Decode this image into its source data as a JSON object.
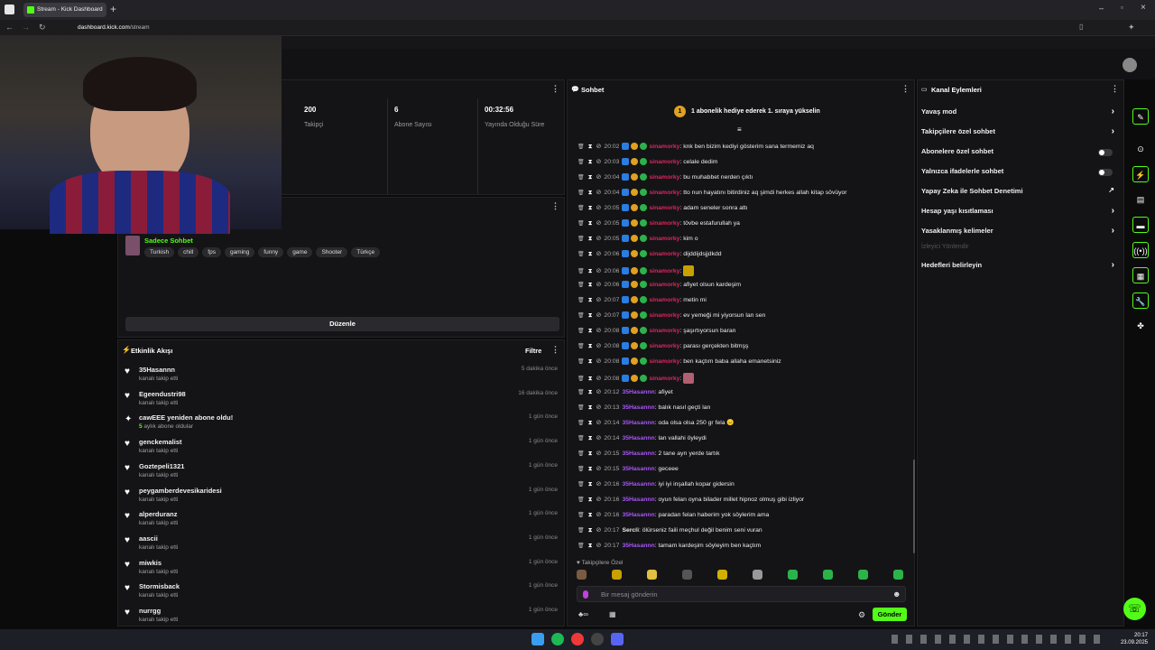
{
  "browser": {
    "tab_title": "Stream - Kick Dashboard",
    "url_host": "dashboard.kick.com",
    "url_path": "/stream"
  },
  "stats": [
    {
      "value": "200",
      "label": "Takipçi"
    },
    {
      "value": "6",
      "label": "Abone Sayısı"
    },
    {
      "value": "00:32:56",
      "label": "Yayında Olduğu Süre"
    }
  ],
  "stream_info": {
    "category": "Sadece Sohbet",
    "tags": [
      "Turkish",
      "chill",
      "fps",
      "gaming",
      "funny",
      "game",
      "Shooter",
      "Türkçe"
    ],
    "edit_button": "Düzenle"
  },
  "activity": {
    "title": "Etkinlik Akışı",
    "filter": "Filtre",
    "items": [
      {
        "name": "35Hasannn",
        "sub": "kanalı takip etti",
        "time": "5 dakika önce",
        "icon": "heart"
      },
      {
        "name": "Egeendustri98",
        "sub": "kanalı takip etti",
        "time": "16 dakika önce",
        "icon": "heart"
      },
      {
        "name": "cawEEE yeniden abone oldu!",
        "sub_accent": "5",
        "sub": " aylık abone oldular",
        "time": "1 gün önce",
        "icon": "star"
      },
      {
        "name": "genckemalist",
        "sub": "kanalı takip etti",
        "time": "1 gün önce",
        "icon": "heart"
      },
      {
        "name": "Goztepeli1321",
        "sub": "kanalı takip etti",
        "time": "1 gün önce",
        "icon": "heart"
      },
      {
        "name": "peygamberdevesikaridesi",
        "sub": "kanalı takip etti",
        "time": "1 gün önce",
        "icon": "heart"
      },
      {
        "name": "alperduranz",
        "sub": "kanalı takip etti",
        "time": "1 gün önce",
        "icon": "heart"
      },
      {
        "name": "aascii",
        "sub": "kanalı takip etti",
        "time": "1 gün önce",
        "icon": "heart"
      },
      {
        "name": "miwkis",
        "sub": "kanalı takip etti",
        "time": "1 gün önce",
        "icon": "heart"
      },
      {
        "name": "Stormisback",
        "sub": "kanalı takip etti",
        "time": "1 gün önce",
        "icon": "heart"
      },
      {
        "name": "nurrgg",
        "sub": "kanalı takip etti",
        "time": "1 gün önce",
        "icon": "heart"
      }
    ]
  },
  "chat": {
    "title": "Sohbet",
    "pinned": "1 abonelik hediye ederek 1. sıraya yükselin",
    "placeholder": "Bir mesaj gönderin",
    "send": "Gönder",
    "followers_only_label": "Takipçilere Özel",
    "messages": [
      {
        "time": "20:02",
        "user": "sinamorky",
        "color": "#e0245e",
        "badges": true,
        "text": ": knk ben bizim kediyi gösterim sana termemiz aq"
      },
      {
        "time": "20:03",
        "user": "sinamorky",
        "color": "#e0245e",
        "badges": true,
        "text": ": celale dedim"
      },
      {
        "time": "20:04",
        "user": "sinamorky",
        "color": "#e0245e",
        "badges": true,
        "text": ": bu muhabbet nerden çıktı"
      },
      {
        "time": "20:04",
        "user": "sinamorky",
        "color": "#e0245e",
        "badges": true,
        "text": ": tto nun hayatını bitirdiniz aq şimdi herkes allah kitap sövüyor"
      },
      {
        "time": "20:05",
        "user": "sinamorky",
        "color": "#e0245e",
        "badges": true,
        "text": ": adam seneler sonra attı"
      },
      {
        "time": "20:05",
        "user": "sinamorky",
        "color": "#e0245e",
        "badges": true,
        "text": ": tövbe estafurullah ya"
      },
      {
        "time": "20:05",
        "user": "sinamorky",
        "color": "#e0245e",
        "badges": true,
        "text": ": kim o"
      },
      {
        "time": "20:06",
        "user": "sinamorky",
        "color": "#e0245e",
        "badges": true,
        "text": ": dijddijdsjjdkdd"
      },
      {
        "time": "20:06",
        "user": "sinamorky",
        "color": "#e0245e",
        "badges": true,
        "text": ": ",
        "emote": "#c8a000"
      },
      {
        "time": "20:06",
        "user": "sinamorky",
        "color": "#e0245e",
        "badges": true,
        "text": ": afiyet olsun kardeşim"
      },
      {
        "time": "20:07",
        "user": "sinamorky",
        "color": "#e0245e",
        "badges": true,
        "text": ": metin mi"
      },
      {
        "time": "20:07",
        "user": "sinamorky",
        "color": "#e0245e",
        "badges": true,
        "text": ": ev yemeği mi yiyorsun lan sen"
      },
      {
        "time": "20:08",
        "user": "sinamorky",
        "color": "#e0245e",
        "badges": true,
        "text": ": şaşırtıyorsun baran"
      },
      {
        "time": "20:08",
        "user": "sinamorky",
        "color": "#e0245e",
        "badges": true,
        "text": ": parası gerçekten bitmşş"
      },
      {
        "time": "20:08",
        "user": "sinamorky",
        "color": "#e0245e",
        "badges": true,
        "text": ": ben kaçtım baba allaha emanetsiniz"
      },
      {
        "time": "20:08",
        "user": "sinamorky",
        "color": "#e0245e",
        "badges": true,
        "text": ": ",
        "emote": "#b06070"
      },
      {
        "time": "20:12",
        "user": "35Hasannn",
        "color": "#a855f7",
        "badges": false,
        "text": ": afiyet"
      },
      {
        "time": "20:13",
        "user": "35Hasannn",
        "color": "#a855f7",
        "badges": false,
        "text": ": balık nasıl geçti lan"
      },
      {
        "time": "20:14",
        "user": "35Hasannn",
        "color": "#a855f7",
        "badges": false,
        "text": ": oda olsa olsa 250 gr fela 😑"
      },
      {
        "time": "20:14",
        "user": "35Hasannn",
        "color": "#a855f7",
        "badges": false,
        "text": ": lan vallahi öyleydi"
      },
      {
        "time": "20:15",
        "user": "35Hasannn",
        "color": "#a855f7",
        "badges": false,
        "text": ": 2 tane ayrı yerde tartık"
      },
      {
        "time": "20:15",
        "user": "35Hasannn",
        "color": "#a855f7",
        "badges": false,
        "text": ": geceee"
      },
      {
        "time": "20:16",
        "user": "35Hasannn",
        "color": "#a855f7",
        "badges": false,
        "text": ": iyi iyi inşallah kopar gidersin"
      },
      {
        "time": "20:16",
        "user": "35Hasannn",
        "color": "#a855f7",
        "badges": false,
        "text": ": oyun felan oyna bilader millet hipnoz olmuş gibi izliyor"
      },
      {
        "time": "20:16",
        "user": "35Hasannn",
        "color": "#a855f7",
        "badges": false,
        "text": ": paradan felan haberim yok söylerim ama"
      },
      {
        "time": "20:17",
        "user": "Sercli",
        "color": "#e8e8e8",
        "badges": false,
        "text": ": ölürseniz faili meçhul değil benim seni vuran"
      },
      {
        "time": "20:17",
        "user": "35Hasannn",
        "color": "#a855f7",
        "badges": false,
        "text": ": tamam kardeşim söyleyim ben kaçtım"
      }
    ]
  },
  "channel_actions": {
    "title": "Kanal Eylemleri",
    "items": [
      {
        "label": "Yavaş mod",
        "type": "chevron"
      },
      {
        "label": "Takipçilere özel sohbet",
        "type": "chevron"
      },
      {
        "label": "Abonelere özel sohbet",
        "type": "toggle"
      },
      {
        "label": "Yalnızca ifadelerle sohbet",
        "type": "toggle"
      },
      {
        "label": "Yapay Zeka ile Sohbet Denetimi",
        "type": "external"
      },
      {
        "label": "Hesap yaşı kısıtlaması",
        "type": "chevron"
      },
      {
        "label": "Yasaklanmış kelimeler",
        "type": "chevron"
      },
      {
        "label": "İzleyici Yönlendir",
        "type": "disabled"
      },
      {
        "label": "Hedefleri belirleyin",
        "type": "chevron"
      }
    ]
  },
  "clock": {
    "time": "20:17",
    "date": "23.09.2025"
  },
  "colors": {
    "accent": "#53fc18",
    "bg": "#0b0b0c",
    "panel": "#141416"
  }
}
